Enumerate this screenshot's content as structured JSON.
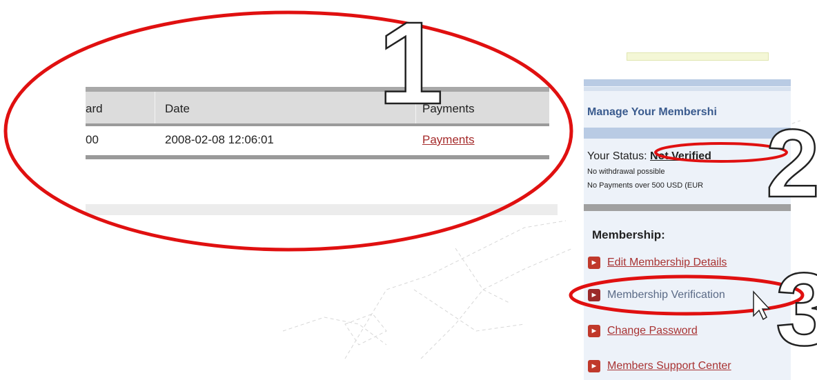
{
  "table": {
    "headers": [
      "ard",
      "Date",
      "Payments"
    ],
    "row": {
      "id_fragment": "00",
      "date": "2008-02-08 12:06:01",
      "payments_link": "Payments"
    }
  },
  "sidebar": {
    "manage_title": "Manage Your Membershi",
    "status_label": "Your Status:",
    "status_value": "Not Verified",
    "note_withdrawal": "No withdrawal possible",
    "note_payments": "No Payments over 500 USD (EUR",
    "membership_heading": "Membership:",
    "menu": [
      {
        "label": "Edit Membership Details",
        "icon": "arrow-bullet-icon"
      },
      {
        "label": "Membership Verification",
        "icon": "arrow-bullet-icon"
      },
      {
        "label": "Change Password",
        "icon": "arrow-bullet-icon"
      },
      {
        "label": "Members Support Center",
        "icon": "arrow-bullet-icon"
      }
    ]
  },
  "annotations": {
    "marker_1": "1",
    "marker_2": "2",
    "marker_3": "3"
  },
  "colors": {
    "annotation_red": "#e01010",
    "link_red": "#a83232",
    "title_blue": "#3a5b8e",
    "sidebar_bg": "#edf2f9"
  },
  "cursor": {
    "icon": "mouse-pointer-icon"
  }
}
